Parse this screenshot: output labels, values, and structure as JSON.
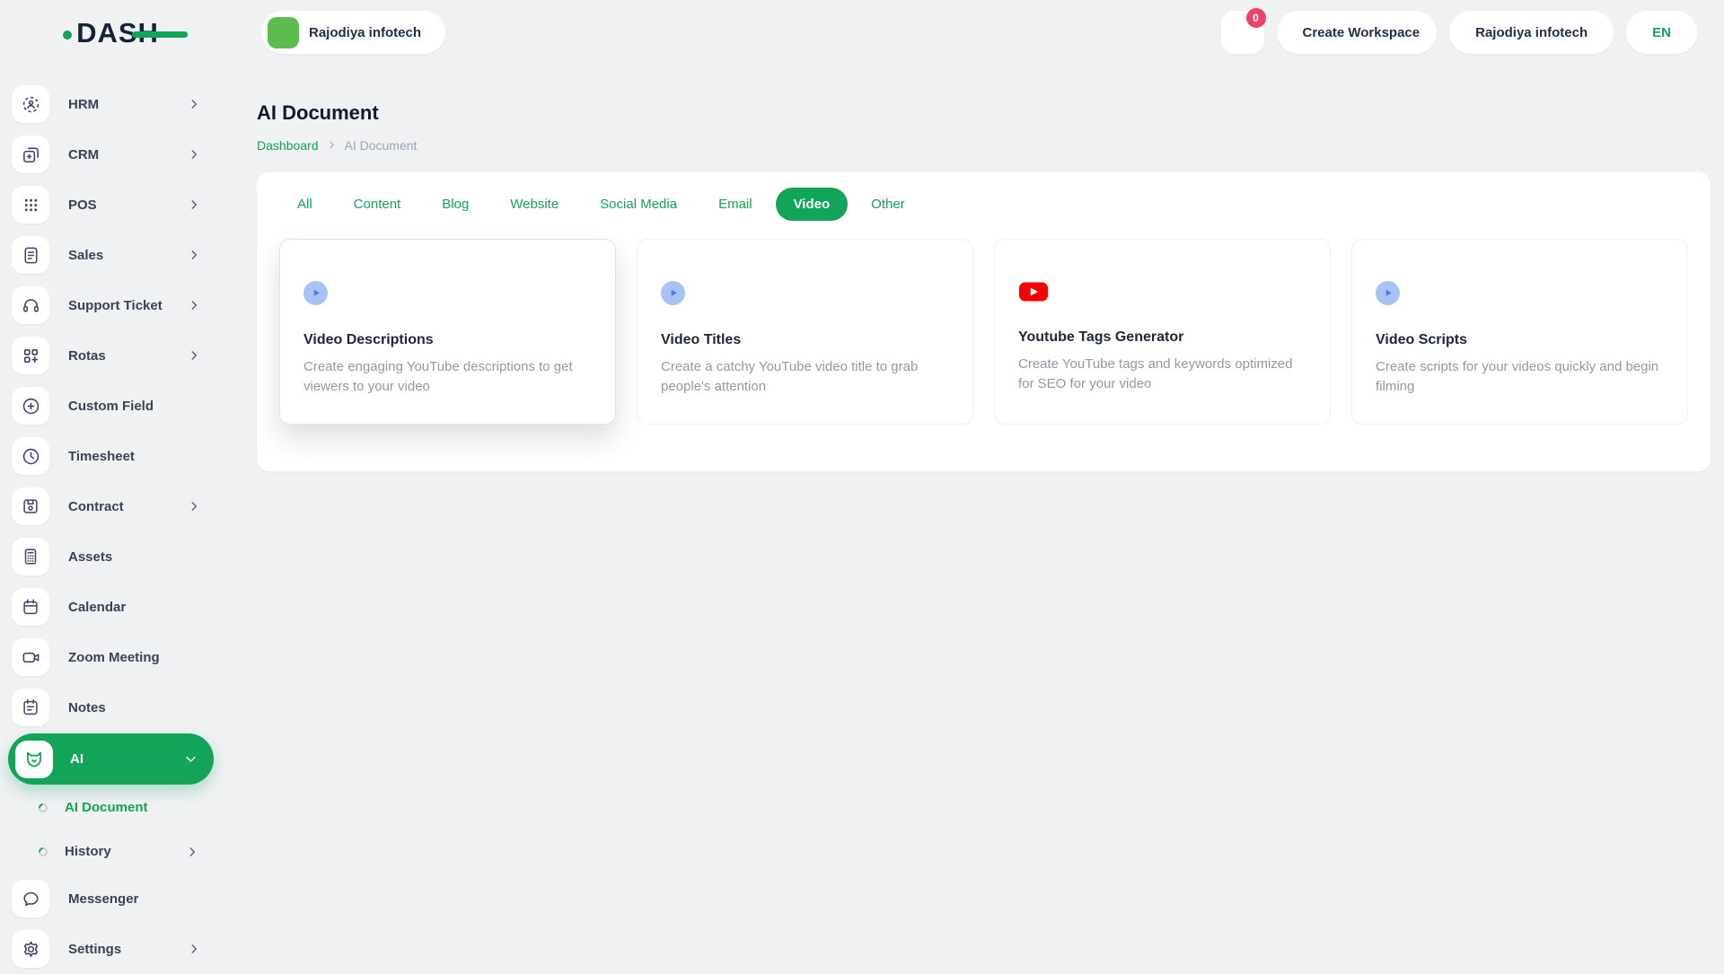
{
  "colors": {
    "primary_green": "#12A458",
    "dark_navy": "#152238",
    "badge_pink": "#F1416C",
    "play_icon_bg": "#A9C2F6",
    "play_icon_fg": "#4C7BE8",
    "youtube_red": "#F60002",
    "page_background": "#EFF1F3"
  },
  "brand": {
    "logo_text": "DASH"
  },
  "header": {
    "workspace": {
      "label": "Rajodiya infotech",
      "icon": "workspace-logo-icon"
    },
    "messages": {
      "icon": "chat-icon",
      "badge": "0"
    },
    "create_workspace": {
      "label": "Create Workspace",
      "icon": "plus-circle-icon"
    },
    "company": {
      "label": "Rajodiya infotech",
      "icon": "org-icon"
    },
    "language": {
      "label": "EN",
      "icon": "globe-icon"
    }
  },
  "sidebar": {
    "items": [
      {
        "label": "HRM",
        "icon": "hrm-icon",
        "chevron": true
      },
      {
        "label": "CRM",
        "icon": "crm-icon",
        "chevron": true
      },
      {
        "label": "POS",
        "icon": "pos-icon",
        "chevron": true
      },
      {
        "label": "Sales",
        "icon": "sales-icon",
        "chevron": true
      },
      {
        "label": "Support Ticket",
        "icon": "support-ticket-icon",
        "chevron": true
      },
      {
        "label": "Rotas",
        "icon": "rotas-icon",
        "chevron": true
      },
      {
        "label": "Custom Field",
        "icon": "custom-field-icon",
        "chevron": false
      },
      {
        "label": "Timesheet",
        "icon": "timesheet-icon",
        "chevron": false
      },
      {
        "label": "Contract",
        "icon": "contract-icon",
        "chevron": true
      },
      {
        "label": "Assets",
        "icon": "assets-icon",
        "chevron": false
      },
      {
        "label": "Calendar",
        "icon": "calendar-icon",
        "chevron": false
      },
      {
        "label": "Zoom Meeting",
        "icon": "zoom-meeting-icon",
        "chevron": false
      },
      {
        "label": "Notes",
        "icon": "notes-icon",
        "chevron": false
      },
      {
        "label": "AI",
        "icon": "ai-fox-icon",
        "active": true,
        "expanded": true,
        "children": [
          {
            "label": "AI Document",
            "active": true,
            "chevron": false
          },
          {
            "label": "History",
            "active": false,
            "chevron": true
          }
        ]
      },
      {
        "label": "Messenger",
        "icon": "messenger-icon",
        "chevron": false
      },
      {
        "label": "Settings",
        "icon": "settings-icon",
        "chevron": true
      }
    ]
  },
  "page": {
    "title": "AI Document",
    "breadcrumb": [
      {
        "label": "Dashboard",
        "link": true
      },
      {
        "label": "AI Document",
        "link": false
      }
    ]
  },
  "tabs": [
    "All",
    "Content",
    "Blog",
    "Website",
    "Social Media",
    "Email",
    "Video",
    "Other"
  ],
  "active_tab": "Video",
  "cards": [
    {
      "icon": "play-circle-icon",
      "title": "Video Descriptions",
      "description": "Create engaging YouTube descriptions to get viewers to your video",
      "highlighted": true
    },
    {
      "icon": "play-circle-icon",
      "title": "Video Titles",
      "description": "Create a catchy YouTube video title to grab people's attention",
      "highlighted": false
    },
    {
      "icon": "youtube-icon",
      "title": "Youtube Tags Generator",
      "description": "Create YouTube tags and keywords optimized for SEO for your video",
      "highlighted": false
    },
    {
      "icon": "play-circle-icon",
      "title": "Video Scripts",
      "description": "Create scripts for your videos quickly and begin filming",
      "highlighted": false
    }
  ]
}
